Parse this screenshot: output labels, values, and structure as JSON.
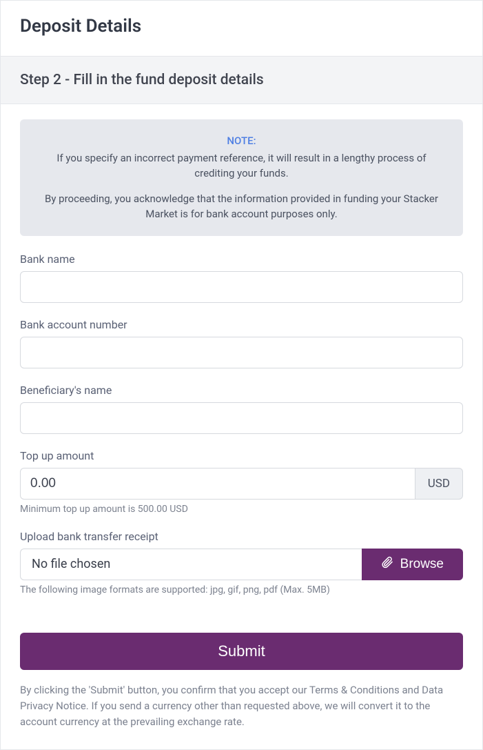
{
  "header": {
    "title": "Deposit Details",
    "step_label": "Step 2 - Fill in the fund deposit details"
  },
  "note": {
    "label": "NOTE:",
    "line1": "If you specify an incorrect payment reference, it will result in a lengthy process of crediting your funds.",
    "line2": "By proceeding, you acknowledge that the information provided in funding your Stacker Market is for bank account purposes only."
  },
  "fields": {
    "bank_name": {
      "label": "Bank name",
      "value": ""
    },
    "bank_account_number": {
      "label": "Bank account number",
      "value": ""
    },
    "beneficiary_name": {
      "label": "Beneficiary's name",
      "value": ""
    },
    "top_up_amount": {
      "label": "Top up amount",
      "value": "0.00",
      "currency": "USD",
      "helper": "Minimum top up amount is 500.00 USD"
    },
    "upload": {
      "label": "Upload bank transfer receipt",
      "filename": "No file chosen",
      "button": "Browse",
      "helper": "The following image formats are supported: jpg, gif, png, pdf (Max. 5MB)"
    }
  },
  "submit": {
    "label": "Submit"
  },
  "disclaimer": "By clicking the 'Submit' button, you confirm that you accept our Terms & Conditions and Data Privacy Notice. If you send a currency other than requested above, we will convert it to the account currency at the prevailing exchange rate."
}
